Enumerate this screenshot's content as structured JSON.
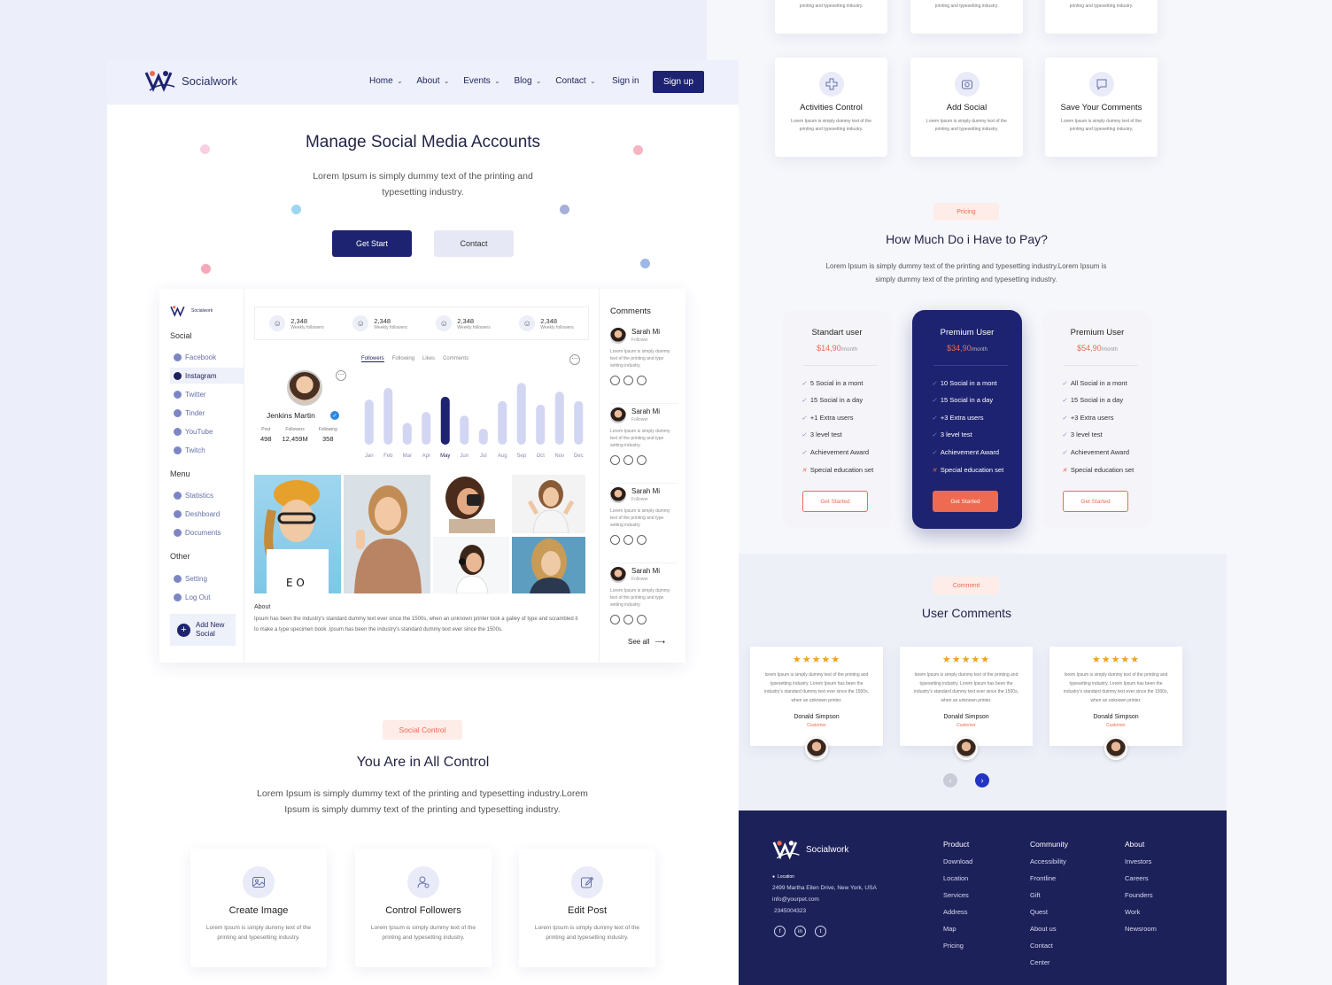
{
  "brand": {
    "name": "Socialwork"
  },
  "nav": {
    "items": [
      "Home",
      "About",
      "Events",
      "Blog",
      "Contact"
    ],
    "signin": "Sign in",
    "signup": "Sign up"
  },
  "hero": {
    "title": "Manage Social Media Accounts",
    "subtitle": "Lorem Ipsum is simply dummy text of the printing and typesetting industry.",
    "start": "Get Start",
    "contact": "Contact"
  },
  "dashboard": {
    "brand": "Socialwork",
    "social_label": "Social",
    "social": [
      "Facebook",
      "Instagram",
      "Twitter",
      "Tinder",
      "YouTube",
      "Twitch"
    ],
    "menu_label": "Menu",
    "menu": [
      "Statistics",
      "Deshboard",
      "Documents"
    ],
    "other_label": "Other",
    "other": [
      "Setting",
      "Log Out"
    ],
    "add_social": "Add New Social",
    "stats": [
      {
        "value": "2,348",
        "label": "Weekly followers"
      },
      {
        "value": "2,348",
        "label": "Weekly followers"
      },
      {
        "value": "2,348",
        "label": "Weekly followers"
      },
      {
        "value": "2,348",
        "label": "Weekly followers"
      }
    ],
    "profile": {
      "name": "Jenkins Martin",
      "post_label": "Post",
      "post": "498",
      "followers_label": "Followers",
      "followers": "12,459M",
      "following_label": "Following",
      "following": "358"
    },
    "tabs": [
      "Followers",
      "Following",
      "Likes",
      "Comments"
    ],
    "about_label": "About",
    "about_text": "Ipsum has been the industry's standard dummy text ever since the 1500s, when an unknown printer took a galley of type and scrambled it to make a type specimen book .Ipsum has been the industry's standard dummy text ever since the 1500s.",
    "comments_title": "Comments",
    "comments": [
      {
        "name": "Sarah Mi",
        "role": "Follower",
        "text": "Lorem Ipsum is simply dummy text of the printing and type setting industry."
      },
      {
        "name": "Sarah Mi",
        "role": "Follower",
        "text": "Lorem Ipsum is simply dummy text of the printing and type setting industry."
      },
      {
        "name": "Sarah Mi",
        "role": "Follower",
        "text": "Lorem Ipsum is simply dummy text of the printing and type setting industry."
      },
      {
        "name": "Sarah Mi",
        "role": "Follower",
        "text": "Lorem Ipsum is simply dummy text of the printing and type setting industry."
      }
    ],
    "see_all": "See all"
  },
  "chart_data": {
    "type": "bar",
    "categories": [
      "Jan",
      "Feb",
      "Mar",
      "Apr",
      "May",
      "Jun",
      "Jul",
      "Aug",
      "Sep",
      "Oct",
      "Nov",
      "Dec"
    ],
    "values": [
      62,
      78,
      30,
      45,
      66,
      40,
      22,
      60,
      85,
      55,
      73,
      60
    ],
    "highlight": "May",
    "colors": {
      "bar": "#d3d6f2",
      "highlight": "#1d2370"
    }
  },
  "control": {
    "tag": "Social Control",
    "title": "You Are in All Control",
    "subtitle": "Lorem Ipsum is simply dummy text of the printing and typesetting industry.Lorem Ipsum is simply dummy text of the printing and typesetting industry.",
    "cards": [
      {
        "title": "Create Image",
        "desc": "Lorem Ipsum is simply dummy text of the printing and typesetting industry."
      },
      {
        "title": "Control Followers",
        "desc": "Lorem Ipsum is simply dummy text of the printing and typesetting industry."
      },
      {
        "title": "Edit Post",
        "desc": "Lorem Ipsum is simply dummy text of the printing and typesetting industry."
      }
    ]
  },
  "features": {
    "top_desc": "Lorem Ipsum is simply dummy text of the printing and typesetting industry.",
    "cards": [
      {
        "title": "Activities Control",
        "desc": "Lorem Ipsum is simply dummy text of the printing and typesetting industry."
      },
      {
        "title": "Add Social",
        "desc": "Lorem Ipsum is simply dummy text of the printing and typesetting industry."
      },
      {
        "title": "Save Your Comments",
        "desc": "Lorem Ipsum is simply dummy text of the printing and typesetting industry."
      }
    ]
  },
  "pricing": {
    "tag": "Pricing",
    "title": "How Much Do i Have to Pay?",
    "subtitle": "Lorem Ipsum is simply dummy text of the printing and typesetting industry.Lorem Ipsum is simply dummy text of the printing and typesetting industry.",
    "month": "/month",
    "plans": [
      {
        "name": "Standart user",
        "price": "$14,90",
        "features": [
          "5 Social in a mont",
          "15 Social in a day",
          "+1 Extra users",
          "3 level test",
          "Achievement Award",
          "Special education set"
        ],
        "button": "Get Started"
      },
      {
        "name": "Premium User",
        "price": "$34,90",
        "features": [
          "10 Social in a mont",
          "15 Social in a day",
          "+3 Extra users",
          "3 level test",
          "Achievement Award",
          "Special education set"
        ],
        "button": "Get Started"
      },
      {
        "name": "Premium User",
        "price": "$54,90",
        "features": [
          "All Social in a mont",
          "15 Social in a day",
          "+3 Extra users",
          "3 level test",
          "Achievement Award",
          "Special education set"
        ],
        "button": "Get Started"
      }
    ]
  },
  "user_comments": {
    "tag": "Comment",
    "title": "User Comments",
    "rating": "★★★★★",
    "items": [
      {
        "text": "lorem Ipsum is simply dummy text of the printing and typesetting industry. Lorem Ipsum has been the industry's standard dummy text ever since the 1500s, when an unknown printer.",
        "name": "Donald Simpson",
        "role": "Customer"
      },
      {
        "text": "lorem Ipsum is simply dummy text of the printing and typesetting industry. Lorem Ipsum has been the industry's standard dummy text ever since the 1500s, when an unknown printer.",
        "name": "Donald Simpson",
        "role": "Customer"
      },
      {
        "text": "lorem Ipsum is simply dummy text of the printing and typesetting industry. Lorem Ipsum has been the industry's standard dummy text ever since the 1500s, when an unknown printer.",
        "name": "Donald Simpson",
        "role": "Customer"
      }
    ]
  },
  "footer": {
    "brand": "Socialwork",
    "location_label": "Location",
    "address": "2499 Martha Ellen Drive, New York, USA",
    "email": "info@yourpet.com",
    "phone": "2345004323",
    "product": {
      "head": "Product",
      "links": [
        "Download",
        "Location",
        "Services",
        "Address",
        "Map",
        "Pricing"
      ]
    },
    "community": {
      "head": "Community",
      "links": [
        "Accessibility",
        "Frontline",
        "Gift",
        "Quest",
        "About us",
        "Contact",
        "Center"
      ]
    },
    "about": {
      "head": "About",
      "links": [
        "Investors",
        "Careers",
        "Founders",
        "Work",
        "Newsroom"
      ]
    }
  }
}
